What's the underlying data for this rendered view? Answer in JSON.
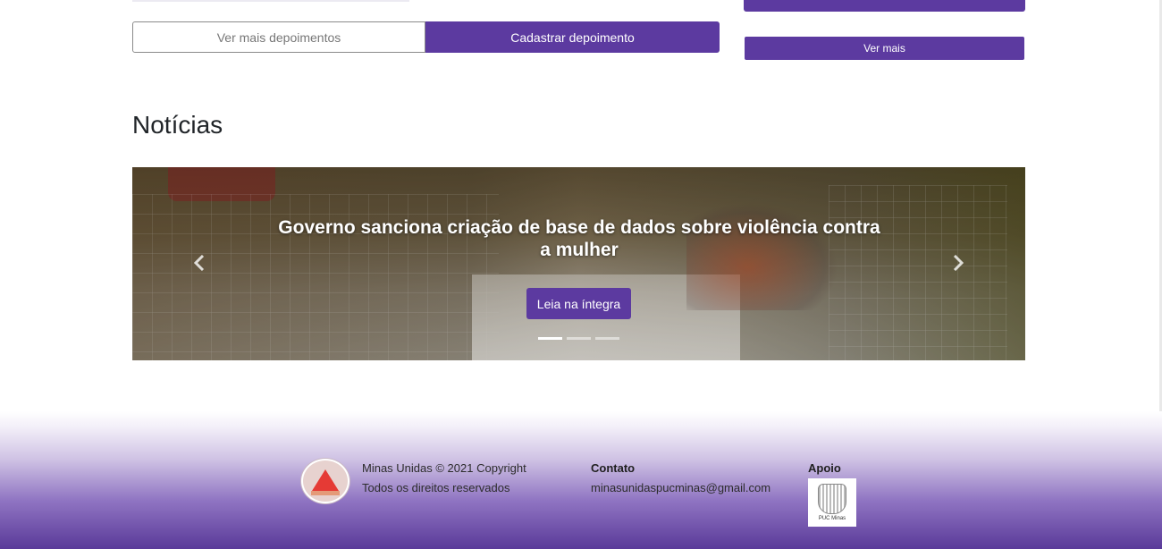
{
  "testimonials": {
    "more_label": "Ver mais depoimentos",
    "register_label": "Cadastrar depoimento"
  },
  "side_panel": {
    "see_more_label": "Ver mais"
  },
  "news": {
    "title": "Notícias",
    "carousel": {
      "headline": "Governo sanciona criação de base de dados sobre violência contra a mulher",
      "read_button": "Leia na íntegra",
      "prev_icon": "chevron-left-icon",
      "next_icon": "chevron-right-icon",
      "slide_count": 3,
      "active_slide": 1
    }
  },
  "footer": {
    "copyright": "Minas Unidas © 2021 Copyright",
    "rights": "Todos os direitos reservados",
    "contact_heading": "Contato",
    "contact_email": "minasunidaspucminas@gmail.com",
    "support_heading": "Apoio",
    "support_logo_text": "PUC Minas"
  },
  "colors": {
    "primary": "#5c3aa0",
    "footer_gradient_end": "#5a3a99"
  }
}
